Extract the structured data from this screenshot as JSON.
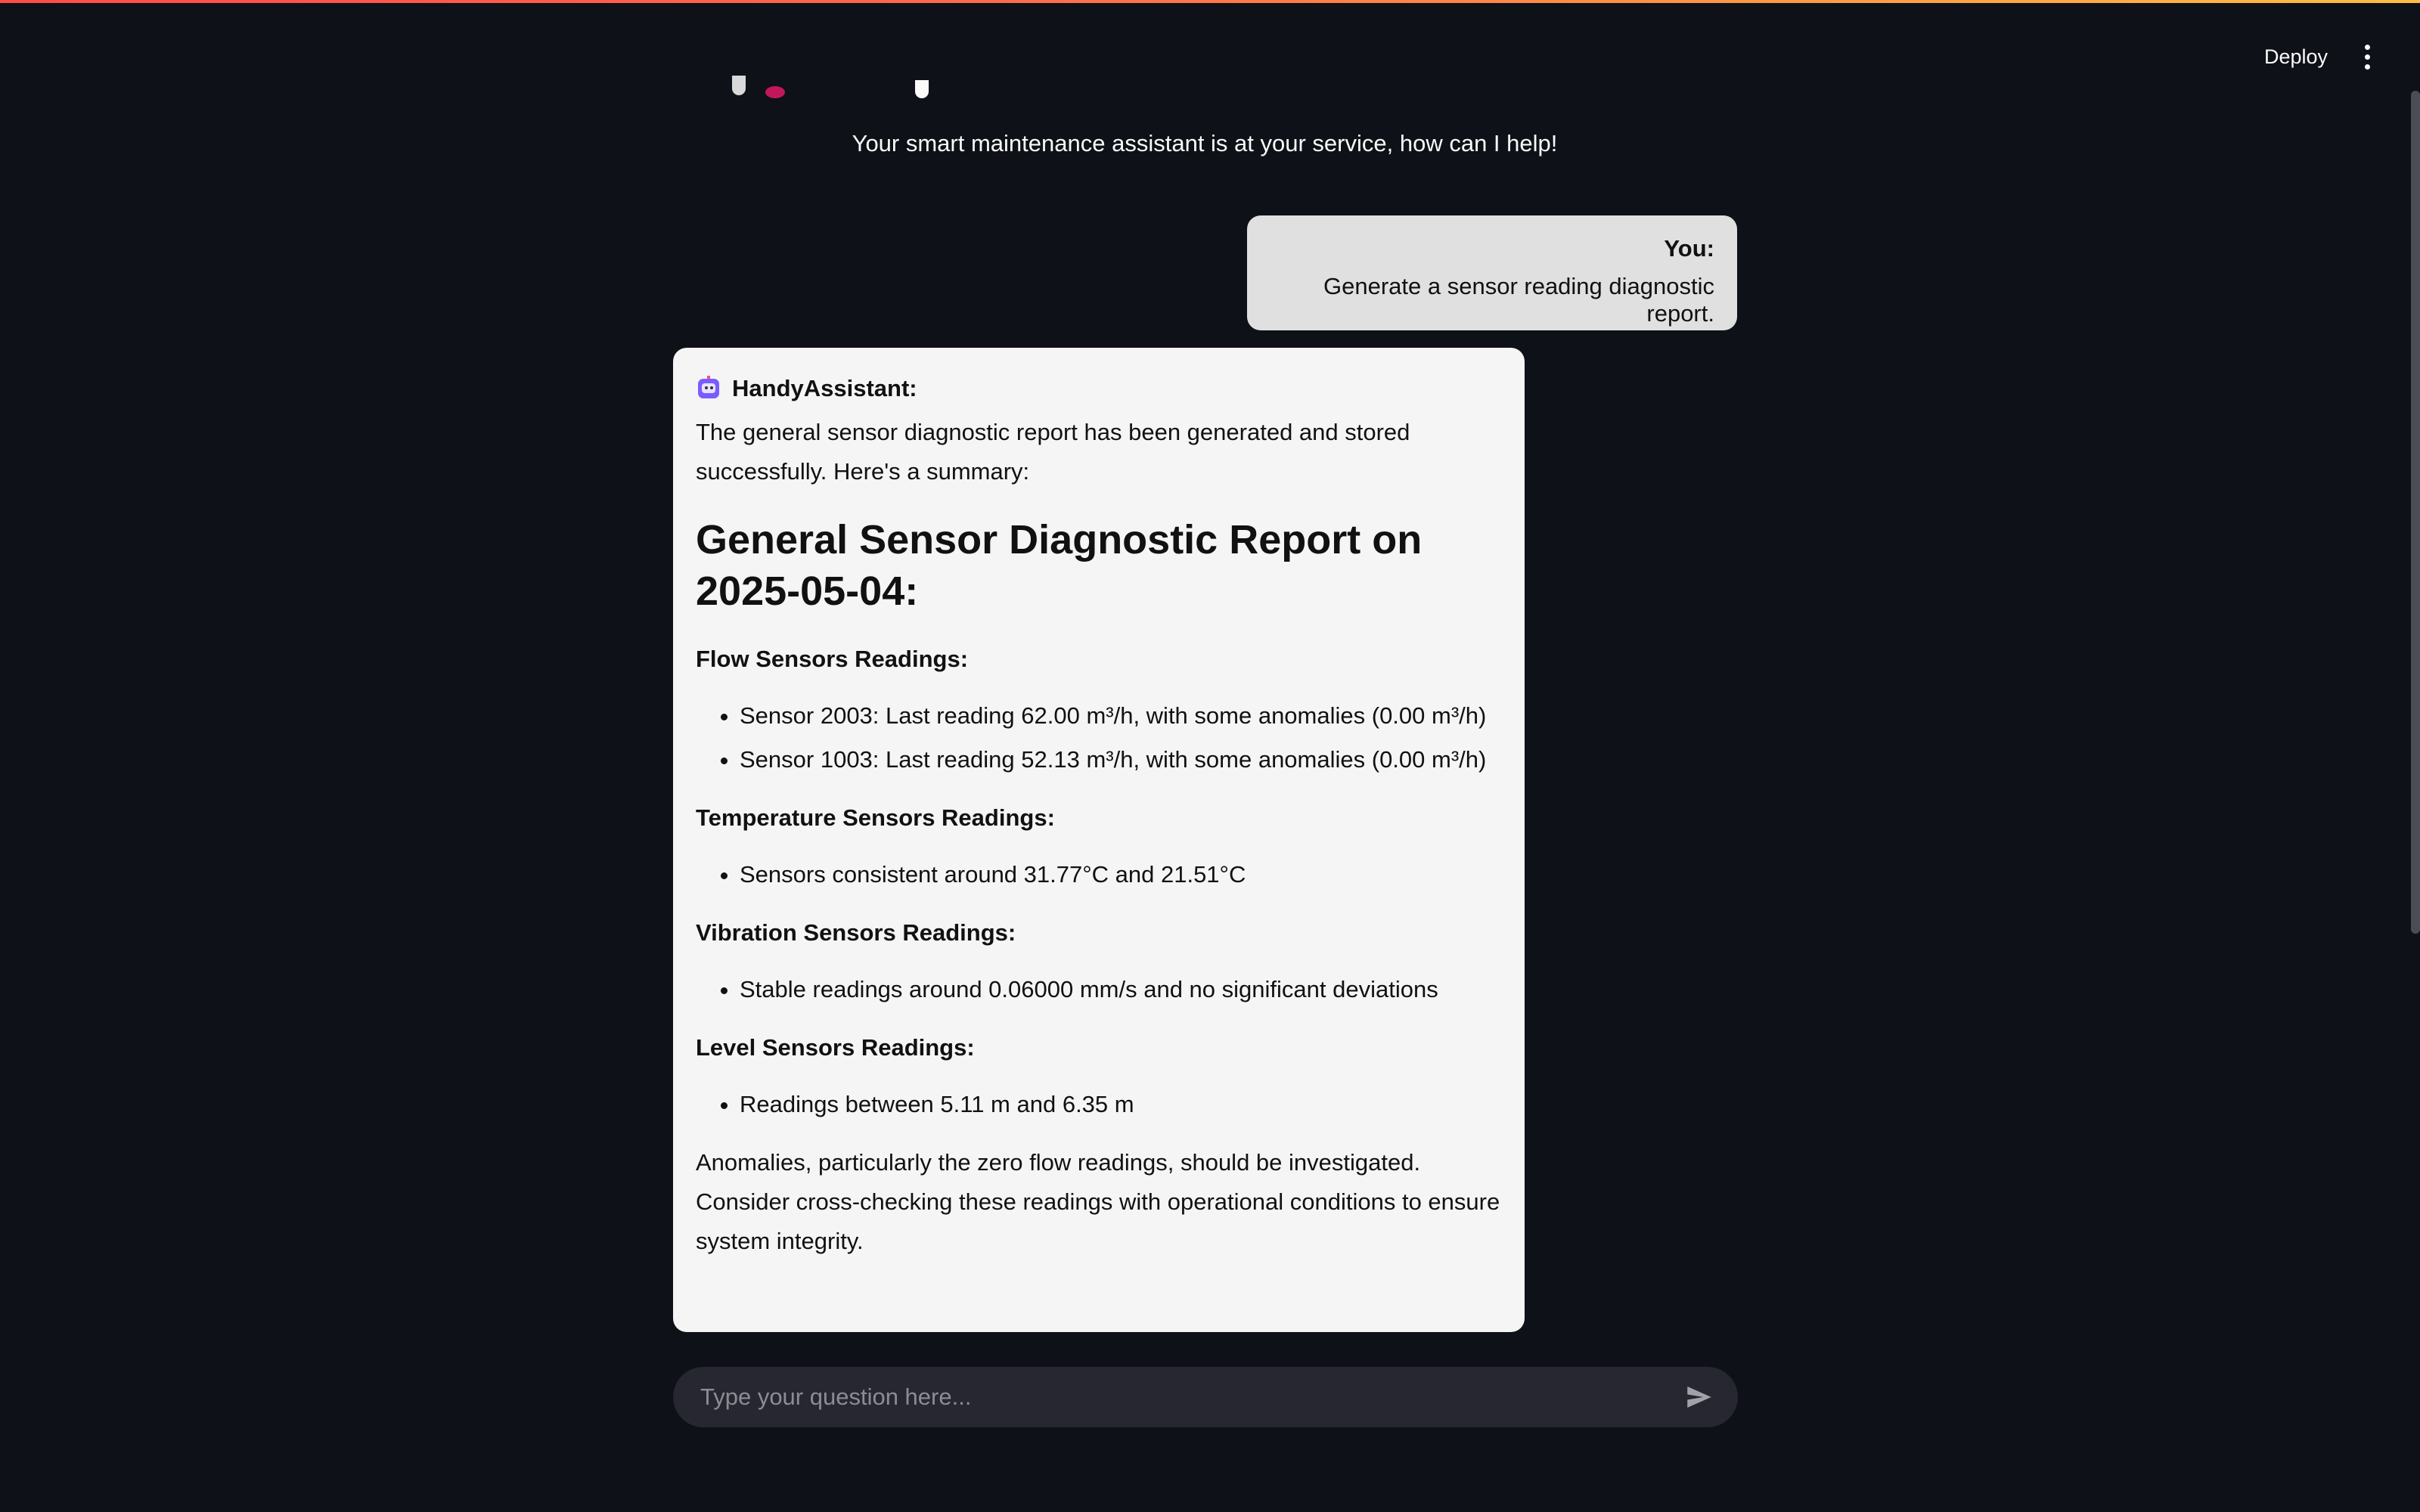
{
  "header": {
    "deploy_label": "Deploy",
    "menu_icon": "vertical-ellipsis-icon",
    "accent_gradient": [
      "#ff4b4b",
      "#ffbd45"
    ]
  },
  "hero": {
    "subtitle": "Your smart maintenance assistant is at your service, how can I help!"
  },
  "chat": {
    "user_message": {
      "sender": "You:",
      "text": "Generate a sensor reading diagnostic report."
    },
    "assistant_message": {
      "icon": "robot-icon",
      "sender": "HandyAssistant:",
      "intro": "The general sensor diagnostic report has been generated and stored successfully. Here's a summary:",
      "report_title": "General Sensor Diagnostic Report on 2025-05-04:",
      "sections": [
        {
          "heading": "Flow Sensors Readings:",
          "items": [
            "Sensor 2003: Last reading 62.00 m³/h, with some anomalies (0.00 m³/h)",
            "Sensor 1003: Last reading 52.13 m³/h, with some anomalies (0.00 m³/h)"
          ]
        },
        {
          "heading": "Temperature Sensors Readings:",
          "items": [
            "Sensors consistent around 31.77°C and 21.51°C"
          ]
        },
        {
          "heading": "Vibration Sensors Readings:",
          "items": [
            "Stable readings around 0.06000 mm/s and no significant deviations"
          ]
        },
        {
          "heading": "Level Sensors Readings:",
          "items": [
            "Readings between 5.11 m and 6.35 m"
          ]
        }
      ],
      "closing": "Anomalies, particularly the zero flow readings, should be investigated. Consider cross-checking these readings with operational conditions to ensure system integrity."
    }
  },
  "input": {
    "placeholder": "Type your question here...",
    "value": "",
    "send_icon": "send-icon"
  },
  "colors": {
    "background": "#0e1117",
    "user_bubble": "#e0e0e0",
    "assistant_card": "#f5f5f5",
    "input_bg": "#262730"
  }
}
